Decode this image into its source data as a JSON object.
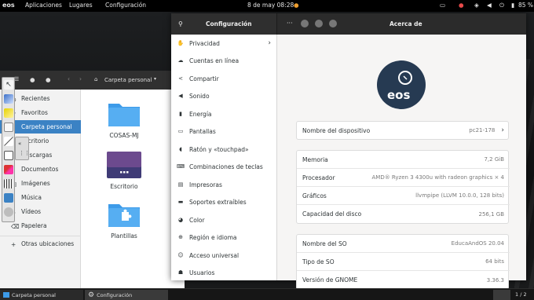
{
  "topbar": {
    "activities": "eos",
    "menus": [
      "Aplicaciones",
      "Lugares",
      "Configuración"
    ],
    "clock": "8 de may 08:28",
    "battery": "85 %"
  },
  "files": {
    "path": "Carpeta personal",
    "sidebar": [
      {
        "label": "Recientes",
        "icon": "clock-icon"
      },
      {
        "label": "Favoritos",
        "icon": "star-icon"
      },
      {
        "label": "Carpeta personal",
        "icon": "home-icon",
        "active": true
      },
      {
        "label": "Escritorio",
        "icon": "desktop-icon"
      },
      {
        "label": "Descargas",
        "icon": "download-icon"
      },
      {
        "label": "Documentos",
        "icon": "document-icon"
      },
      {
        "label": "Imágenes",
        "icon": "image-icon"
      },
      {
        "label": "Música",
        "icon": "music-icon"
      },
      {
        "label": "Vídeos",
        "icon": "video-icon"
      },
      {
        "label": "Papelera",
        "icon": "trash-icon"
      },
      {
        "label": "Otras ubicaciones",
        "icon": "plus-icon"
      }
    ],
    "items": [
      {
        "label": "COSAS-MJ",
        "kind": "folder"
      },
      {
        "label": "Escritorio",
        "kind": "desktop-folder"
      },
      {
        "label": "Plantillas",
        "kind": "templates-folder"
      }
    ]
  },
  "settings": {
    "title": "Configuración",
    "panel_title": "Acerca de",
    "nav": [
      {
        "label": "Privacidad",
        "icon": "privacy-icon",
        "chevron": true
      },
      {
        "label": "Cuentas en línea",
        "icon": "cloud-icon"
      },
      {
        "label": "Compartir",
        "icon": "share-icon"
      },
      {
        "label": "Sonido",
        "icon": "speaker-icon"
      },
      {
        "label": "Energía",
        "icon": "power-icon"
      },
      {
        "label": "Pantallas",
        "icon": "display-icon"
      },
      {
        "label": "Ratón y «touchpad»",
        "icon": "mouse-icon"
      },
      {
        "label": "Combinaciones de teclas",
        "icon": "keyboard-icon"
      },
      {
        "label": "Impresoras",
        "icon": "printer-icon"
      },
      {
        "label": "Soportes extraíbles",
        "icon": "media-icon"
      },
      {
        "label": "Color",
        "icon": "color-icon"
      },
      {
        "label": "Región e idioma",
        "icon": "globe-icon"
      },
      {
        "label": "Acceso universal",
        "icon": "accessibility-icon"
      },
      {
        "label": "Usuarios",
        "icon": "users-icon"
      }
    ],
    "logo_text": "eos",
    "device": {
      "label": "Nombre del dispositivo",
      "value": "pc21-178"
    },
    "hardware": [
      {
        "label": "Memoria",
        "value": "7,2 GiB"
      },
      {
        "label": "Procesador",
        "value": "AMD® Ryzen 3 4300u with radeon graphics × 4"
      },
      {
        "label": "Gráficos",
        "value": "llvmpipe (LLVM 10.0.0, 128 bits)"
      },
      {
        "label": "Capacidad del disco",
        "value": "256,1 GB"
      }
    ],
    "os": [
      {
        "label": "Nombre del SO",
        "value": "EducaAndOS 20.04"
      },
      {
        "label": "Tipo de SO",
        "value": "64 bits"
      },
      {
        "label": "Versión de GNOME",
        "value": "3.36.3"
      }
    ]
  },
  "taskbar": {
    "items": [
      "Carpeta personal",
      "Configuración"
    ],
    "pager": "1 / 2"
  },
  "colors": {
    "accent": "#3b82c4",
    "folder": "#3d9be9",
    "topbar": "#000000"
  }
}
